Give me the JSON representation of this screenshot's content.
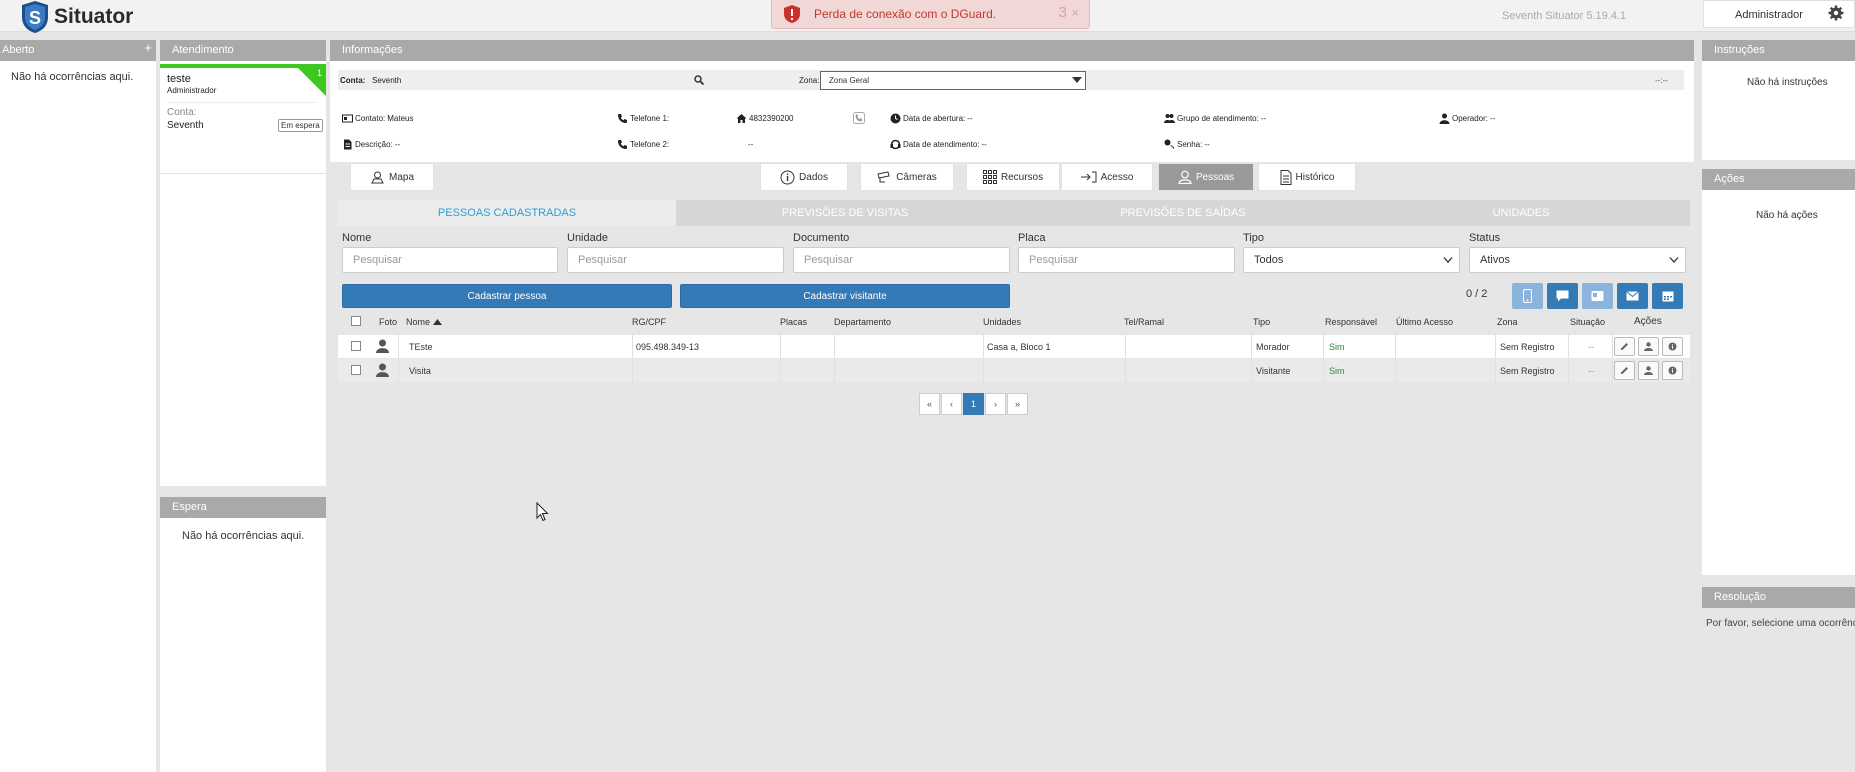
{
  "app": {
    "name": "Situator",
    "version": "Seventh Situator 5.19.4.1",
    "user": "Administrador"
  },
  "alert": {
    "text": "Perda de conexão com o DGuard.",
    "count": "3",
    "close": "×"
  },
  "left": {
    "aberto": {
      "title": "Aberto",
      "plus": "+",
      "empty": "Não há ocorrências aqui."
    },
    "atendimento": {
      "title": "Atendimento",
      "card": {
        "num": "1",
        "title": "teste",
        "role": "Administrador",
        "conta_label": "Conta:",
        "conta_value": "Seventh",
        "badge": "Em espera"
      }
    },
    "espera": {
      "title": "Espera",
      "empty": "Não há ocorrências aqui."
    }
  },
  "info": {
    "title": "Informações",
    "conta_label": "Conta:",
    "conta_value": "Seventh",
    "zona_label": "Zona:",
    "zona_value": "Zona Geral",
    "time": "--:--",
    "contato_label": "Contato:",
    "contato_value": "Mateus",
    "telefone1_label": "Telefone 1:",
    "telefone1_value": "4832390200",
    "data_abertura_label": "Data de abertura:",
    "data_abertura_value": "--",
    "grupo_label": "Grupo de atendimento:",
    "grupo_value": "--",
    "operador_label": "Operador:",
    "operador_value": "--",
    "descricao_label": "Descrição:",
    "descricao_value": "--",
    "telefone2_label": "Telefone 2:",
    "telefone2_value": "--",
    "data_atendimento_label": "Data de atendimento:",
    "data_atendimento_value": "--",
    "senha_label": "Senha:",
    "senha_value": "--"
  },
  "tabs": {
    "mapa": "Mapa",
    "dados": "Dados",
    "cameras": "Câmeras",
    "recursos": "Recursos",
    "acesso": "Acesso",
    "pessoas": "Pessoas",
    "historico": "Histórico"
  },
  "subtabs": {
    "cadastradas": "PESSOAS CADASTRADAS",
    "visitas": "PREVISÕES DE VISITAS",
    "saidas": "PREVISÕES DE SAÍDAS",
    "unidades": "UNIDADES"
  },
  "filters": {
    "nome_label": "Nome",
    "unidade_label": "Unidade",
    "documento_label": "Documento",
    "placa_label": "Placa",
    "tipo_label": "Tipo",
    "status_label": "Status",
    "placeholder": "Pesquisar",
    "tipo_value": "Todos",
    "status_value": "Ativos"
  },
  "buttons": {
    "cadastrar_pessoa": "Cadastrar pessoa",
    "cadastrar_visitante": "Cadastrar visitante",
    "count": "0 / 2"
  },
  "table": {
    "headers": {
      "foto": "Foto",
      "nome": "Nome",
      "rg": "RG/CPF",
      "placas": "Placas",
      "departamento": "Departamento",
      "unidades": "Unidades",
      "tel": "Tel/Ramal",
      "tipo": "Tipo",
      "responsavel": "Responsável",
      "ultimo": "Último Acesso",
      "zona": "Zona",
      "situacao": "Situação",
      "acoes": "Ações"
    },
    "rows": [
      {
        "nome": "TEste",
        "rg": "095.498.349-13",
        "unidades": "Casa a, Bloco 1",
        "tipo": "Morador",
        "responsavel": "Sim",
        "zona": "Sem Registro",
        "situacao": "--"
      },
      {
        "nome": "Visita",
        "rg": "",
        "unidades": "",
        "tipo": "Visitante",
        "responsavel": "Sim",
        "zona": "Sem Registro",
        "situacao": "--"
      }
    ]
  },
  "pagination": {
    "first": "«",
    "prev": "‹",
    "page": "1",
    "next": "›",
    "last": "»"
  },
  "right": {
    "instrucoes": {
      "title": "Instruções",
      "empty": "Não há instruções"
    },
    "acoes": {
      "title": "Ações",
      "empty": "Não há ações"
    },
    "resolucao": {
      "title": "Resolução",
      "text": "Por favor, selecione uma ocorrência"
    }
  }
}
